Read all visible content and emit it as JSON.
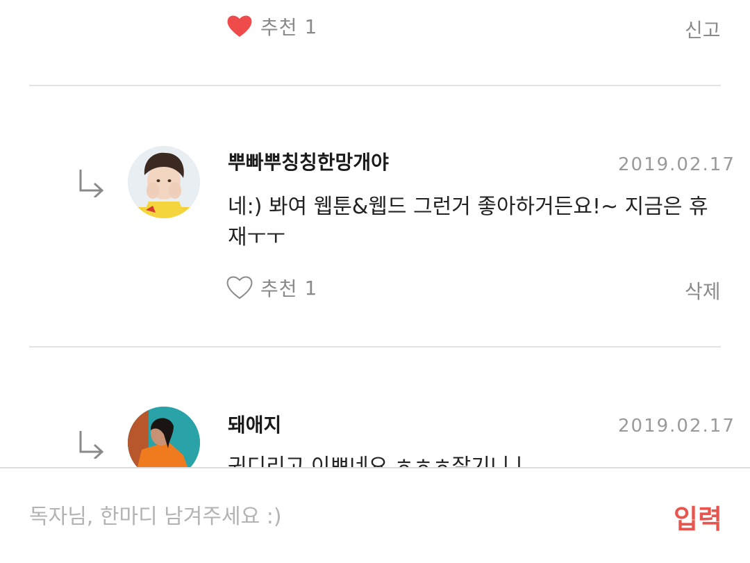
{
  "comments": [
    {
      "recommend_label": "추천",
      "recommend_count": "1",
      "liked": true,
      "right_action": "신고"
    },
    {
      "username": "뿌빠뿌칭칭한망개야",
      "date": "2019.02.17",
      "content": "네:) 봐여 웹툰&웹드 그런거 좋아하거든요!~ 지금은 휴재ㅜㅜ",
      "recommend_label": "추천",
      "recommend_count": "1",
      "liked": false,
      "right_action": "삭제"
    },
    {
      "username": "돼애지",
      "date": "2019.02.17",
      "content": "귀디리고 이쁘네요 ㅎㅎㅎ잘기니ㅣ",
      "avatar_bg": "#2aa3a8"
    }
  ],
  "input": {
    "placeholder": "독자님, 한마디 남겨주세요 :)",
    "value": "",
    "submit_label": "입력"
  },
  "colors": {
    "accent": "#e8554e",
    "heart_filled": "#f04b4b",
    "divider": "#e4e4e4"
  },
  "icons": [
    "heart-filled-icon",
    "heart-outline-icon",
    "reply-arrow-icon"
  ]
}
